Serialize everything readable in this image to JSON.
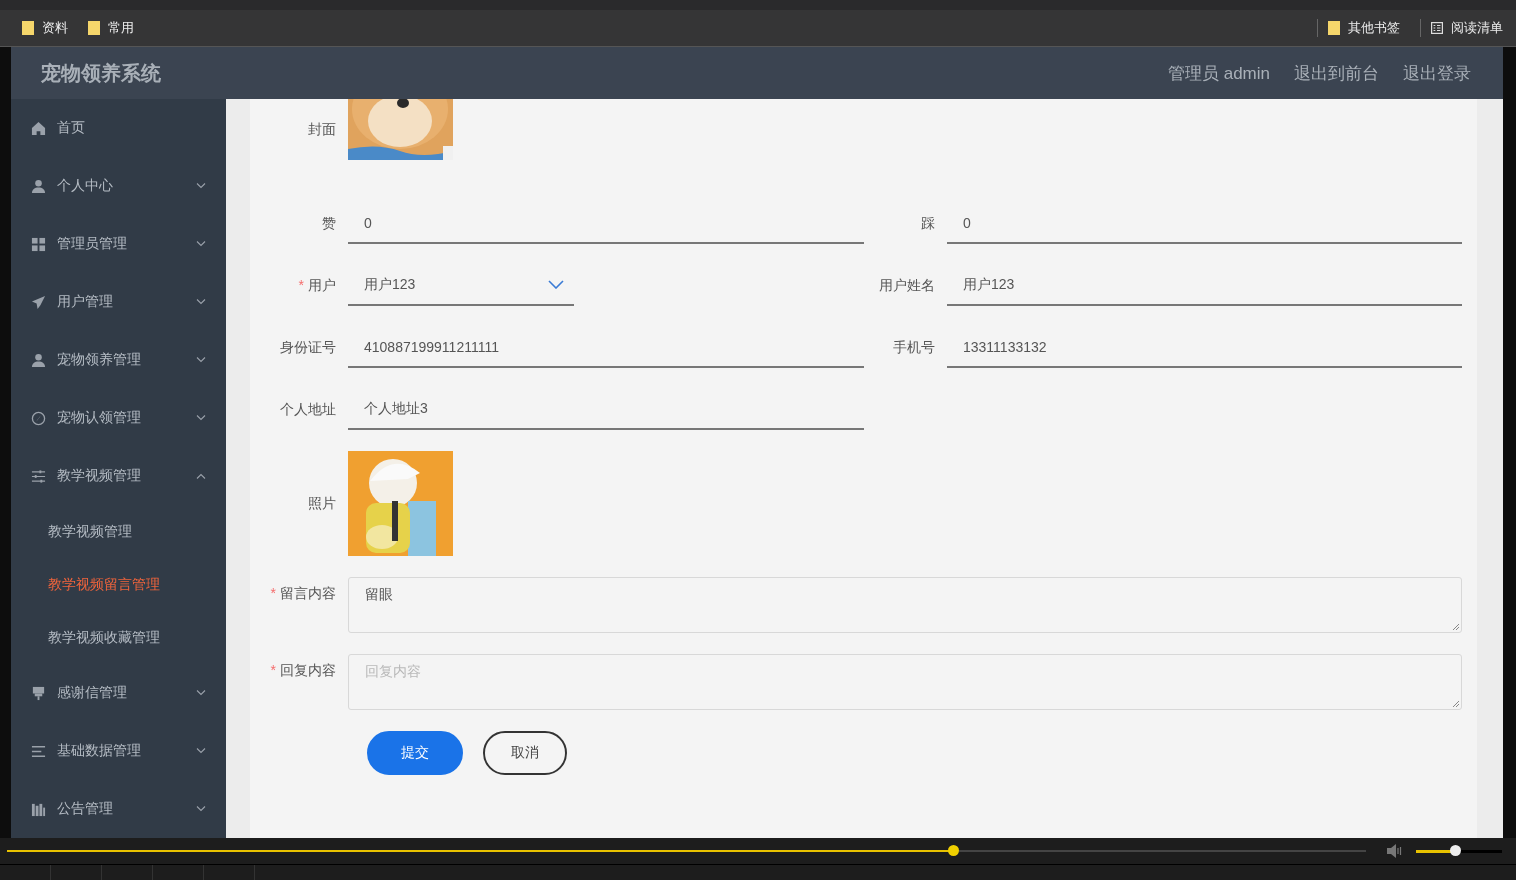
{
  "bookmarks": {
    "left": [
      {
        "label": "资料"
      },
      {
        "label": "常用"
      }
    ],
    "right": [
      {
        "label": "其他书签",
        "kind": "folder"
      },
      {
        "label": "阅读清单",
        "kind": "reading"
      }
    ]
  },
  "header": {
    "title": "宠物领养系统",
    "links": [
      "管理员 admin",
      "退出到前台",
      "退出登录"
    ]
  },
  "sidebar": {
    "items": [
      {
        "label": "首页"
      },
      {
        "label": "个人中心",
        "expanded": false
      },
      {
        "label": "管理员管理",
        "expanded": false
      },
      {
        "label": "用户管理",
        "expanded": false
      },
      {
        "label": "宠物领养管理",
        "expanded": false
      },
      {
        "label": "宠物认领管理",
        "expanded": false
      },
      {
        "label": "教学视频管理",
        "expanded": true,
        "children": [
          {
            "label": "教学视频管理",
            "selected": false
          },
          {
            "label": "教学视频留言管理",
            "selected": true
          },
          {
            "label": "教学视频收藏管理",
            "selected": false
          }
        ]
      },
      {
        "label": "感谢信管理",
        "expanded": false
      },
      {
        "label": "基础数据管理",
        "expanded": false
      },
      {
        "label": "公告管理",
        "expanded": false
      }
    ]
  },
  "form": {
    "rows": [
      [
        {
          "label": "封面"
        }
      ],
      [
        {
          "kind": "text",
          "label": "赞",
          "value": "0"
        },
        {
          "kind": "text",
          "label": "踩",
          "value": "0"
        }
      ],
      [
        {
          "kind": "select",
          "label": "用户",
          "mark": "*",
          "value": "用户123"
        },
        {
          "kind": "text",
          "label": "用户姓名",
          "value": "用户123"
        }
      ],
      [
        {
          "kind": "text",
          "label": "身份证号",
          "value": "410887199911211111"
        },
        {
          "kind": "text",
          "label": "手机号",
          "value": "13311133132"
        }
      ],
      [
        {
          "kind": "text",
          "label": "个人地址",
          "value": "个人地址3"
        }
      ],
      [
        {
          "label": "照片"
        }
      ],
      [
        {
          "kind": "textarea",
          "label": "留言内容",
          "mark": "*",
          "value": "留眼"
        }
      ],
      [
        {
          "kind": "textarea",
          "label": "回复内容",
          "mark": "*",
          "placeholder": "回复内容"
        }
      ]
    ],
    "buttons": [
      {
        "label": "提交",
        "kind": "primary"
      },
      {
        "label": "取消",
        "kind": "default"
      }
    ]
  },
  "player": {
    "progress": {
      "level": 0.696
    },
    "volume": {
      "level": 0.45
    }
  }
}
